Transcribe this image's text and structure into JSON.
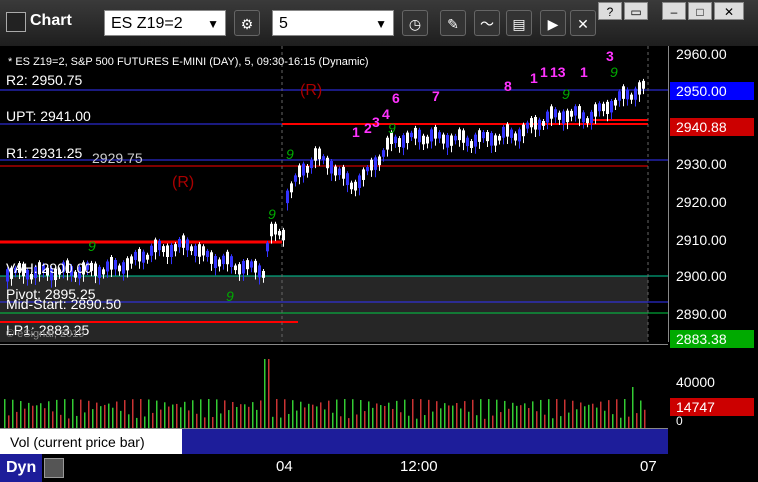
{
  "app": {
    "title": "Chart"
  },
  "toolbar": {
    "symbol": "ES Z19=2",
    "interval": "5"
  },
  "chart": {
    "header": "* ES Z19=2, S&P 500 FUTURES E-MINI (DAY), 5, 09:30-16:15 (Dynamic)",
    "price_ticks": [
      "2960.00",
      "2950.00",
      "2940.00",
      "2930.00",
      "2920.00",
      "2910.00",
      "2900.00",
      "2890.00"
    ],
    "tag_2950": "2950.00",
    "tag_2940": "2940.88",
    "tag_2883": "2883.38",
    "levels": {
      "r2": "R2: 2950.75",
      "upt": "UPT: 2941.00",
      "r1": "R1: 2931.25",
      "r1_overlap": "2929.75",
      "vah": "VAH: 2900.00",
      "pivot": "Pivot: 2895.25",
      "mid": "Mid-Start: 2890.50",
      "lp1": "LP1: 2883.25",
      "r_marker": "(R)"
    },
    "count_labels": [
      "1",
      "2",
      "3",
      "4",
      "6",
      "7",
      "8",
      "1",
      "1",
      "13",
      "1",
      "3"
    ],
    "setup_labels": [
      "9",
      "9",
      "9",
      "9",
      "9",
      "9",
      "9"
    ],
    "watermark": "© eSignal, 2019"
  },
  "volume": {
    "ticks": [
      "40000",
      "0"
    ],
    "tag": "14747",
    "label": "Vol (current price bar)",
    "close": "×"
  },
  "xaxis": {
    "labels": [
      "04",
      "12:00",
      "07"
    ]
  },
  "status": {
    "mode": "Dyn"
  },
  "colors": {
    "up": "#ffffff",
    "down": "#3333ff",
    "setup": "#00aa00",
    "count": "#ff33ff",
    "level": "#ff0000",
    "accent": "#0000ff"
  }
}
